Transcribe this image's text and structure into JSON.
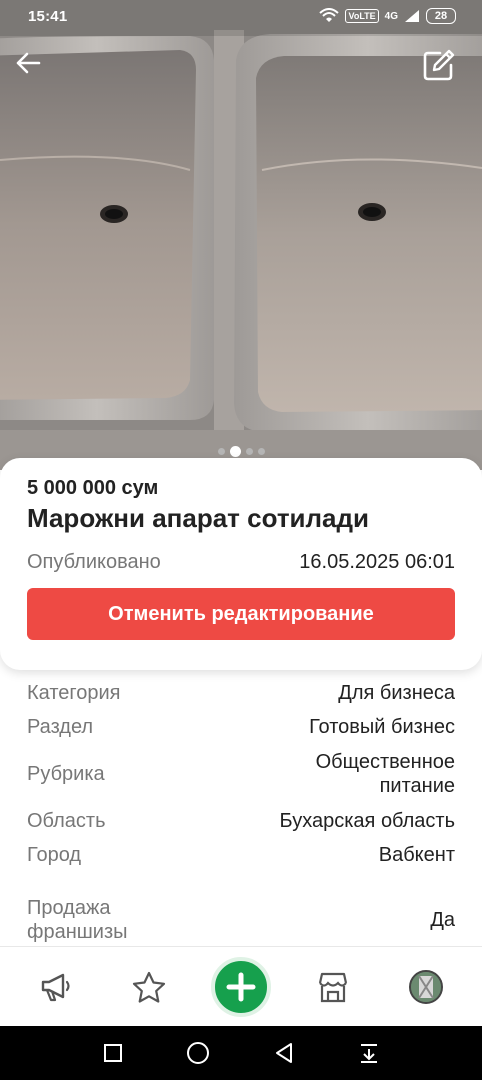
{
  "status_bar": {
    "time": "15:41",
    "network": "4G",
    "volte": "VoLTE",
    "battery": "28"
  },
  "hero": {
    "back_icon": "arrow-left-icon",
    "edit_icon": "edit-icon",
    "pagination": {
      "count": 4,
      "active_index": 1
    }
  },
  "ad": {
    "price": "5 000 000 сум",
    "title": "Марожни апарат сотилади",
    "published_label": "Опубликовано",
    "published_date": "16.05.2025 06:01",
    "cancel_button": "Отменить редактирование"
  },
  "details": [
    {
      "label": "Категория",
      "value": "Для бизнеса"
    },
    {
      "label": "Раздел",
      "value": "Готовый бизнес"
    },
    {
      "label": "Рубрика",
      "value": "Общественное питание"
    },
    {
      "label": "Область",
      "value": "Бухарская область"
    },
    {
      "label": "Город",
      "value": "Вабкент"
    },
    {
      "label": "Продажа франшизы",
      "value": "Да"
    }
  ],
  "bottom_nav": {
    "items": [
      "megaphone-icon",
      "star-icon",
      "add-icon",
      "shop-icon",
      "avatar"
    ],
    "accent": "#16a04d"
  },
  "colors": {
    "accent_red": "#ee4a44",
    "accent_green": "#16a04d"
  }
}
